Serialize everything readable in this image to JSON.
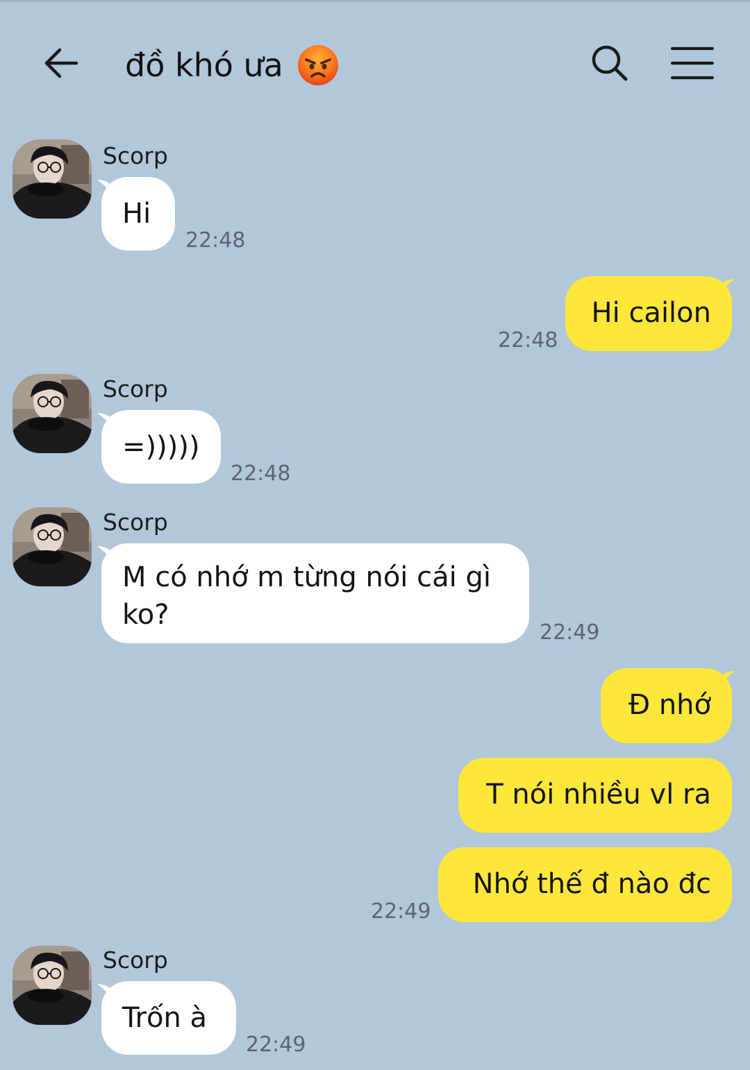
{
  "header": {
    "title": "đồ khó ưa",
    "title_emoji": "angry-face-emoji",
    "back_icon": "arrow-left-icon",
    "search_icon": "search-icon",
    "menu_icon": "hamburger-menu-icon"
  },
  "colors": {
    "background": "#b2c7da",
    "incoming_bubble": "#ffffff",
    "outgoing_bubble": "#fde73a"
  },
  "messages": [
    {
      "direction": "in",
      "sender": "Scorp",
      "text": "Hi",
      "time": "22:48"
    },
    {
      "direction": "out",
      "text": "Hi cailon",
      "time": "22:48"
    },
    {
      "direction": "in",
      "sender": "Scorp",
      "text": "=)))))",
      "time": "22:48"
    },
    {
      "direction": "in",
      "sender": "Scorp",
      "text_line1": "M có nhớ m từng nói cái gì",
      "text_line2": "ko?",
      "time": "22:49"
    },
    {
      "direction": "out",
      "text": "Đ nhớ"
    },
    {
      "direction": "out",
      "text": "T nói nhiều vl ra"
    },
    {
      "direction": "out",
      "text": "Nhớ thế đ nào đc",
      "time": "22:49"
    },
    {
      "direction": "in",
      "sender": "Scorp",
      "text": "Trốn à",
      "time": "22:49"
    }
  ]
}
